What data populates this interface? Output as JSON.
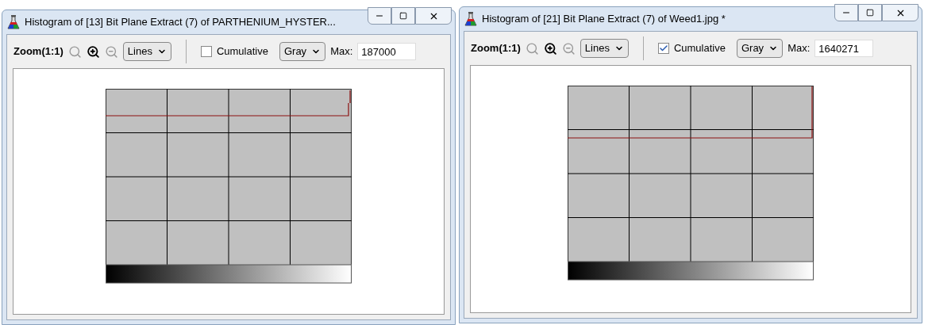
{
  "windows": [
    {
      "title": "Histogram of [13] Bit Plane Extract (7) of PARTHENIUM_HYSTER...",
      "toolbar": {
        "zoom_label": "Zoom(1:1)",
        "plot_style": "Lines",
        "cumulative_label": "Cumulative",
        "cumulative": false,
        "channel": "Gray",
        "max_label": "Max:",
        "max_value": "187000"
      }
    },
    {
      "title": "Histogram of [21] Bit Plane Extract (7) of Weed1.jpg *",
      "toolbar": {
        "zoom_label": "Zoom(1:1)",
        "plot_style": "Lines",
        "cumulative_label": "Cumulative",
        "cumulative": true,
        "channel": "Gray",
        "max_label": "Max:",
        "max_value": "1640271"
      }
    }
  ]
}
